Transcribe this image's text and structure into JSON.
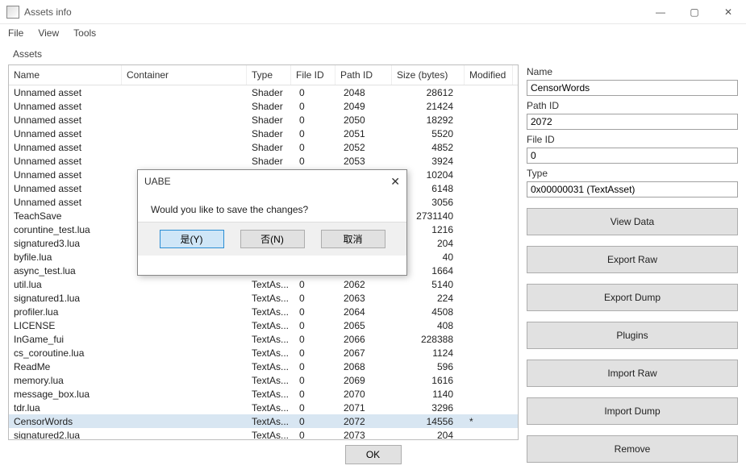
{
  "window": {
    "title": "Assets info"
  },
  "menu": {
    "file": "File",
    "view": "View",
    "tools": "Tools"
  },
  "assets_label": "Assets",
  "columns": {
    "name": "Name",
    "container": "Container",
    "type": "Type",
    "fileid": "File ID",
    "pathid": "Path ID",
    "size": "Size (bytes)",
    "modified": "Modified"
  },
  "rows": [
    {
      "name": "Unnamed asset",
      "container": "",
      "type": "Shader",
      "fileid": "0",
      "pathid": "2048",
      "size": "28612",
      "modified": ""
    },
    {
      "name": "Unnamed asset",
      "container": "",
      "type": "Shader",
      "fileid": "0",
      "pathid": "2049",
      "size": "21424",
      "modified": ""
    },
    {
      "name": "Unnamed asset",
      "container": "",
      "type": "Shader",
      "fileid": "0",
      "pathid": "2050",
      "size": "18292",
      "modified": ""
    },
    {
      "name": "Unnamed asset",
      "container": "",
      "type": "Shader",
      "fileid": "0",
      "pathid": "2051",
      "size": "5520",
      "modified": ""
    },
    {
      "name": "Unnamed asset",
      "container": "",
      "type": "Shader",
      "fileid": "0",
      "pathid": "2052",
      "size": "4852",
      "modified": ""
    },
    {
      "name": "Unnamed asset",
      "container": "",
      "type": "Shader",
      "fileid": "0",
      "pathid": "2053",
      "size": "3924",
      "modified": ""
    },
    {
      "name": "Unnamed asset",
      "container": "",
      "type": "",
      "fileid": "",
      "pathid": "",
      "size": "10204",
      "modified": ""
    },
    {
      "name": "Unnamed asset",
      "container": "",
      "type": "",
      "fileid": "",
      "pathid": "",
      "size": "6148",
      "modified": ""
    },
    {
      "name": "Unnamed asset",
      "container": "",
      "type": "",
      "fileid": "",
      "pathid": "",
      "size": "3056",
      "modified": ""
    },
    {
      "name": "TeachSave",
      "container": "",
      "type": "",
      "fileid": "",
      "pathid": "",
      "size": "2731140",
      "modified": ""
    },
    {
      "name": "coruntine_test.lua",
      "container": "",
      "type": "",
      "fileid": "",
      "pathid": "",
      "size": "1216",
      "modified": ""
    },
    {
      "name": "signatured3.lua",
      "container": "",
      "type": "",
      "fileid": "",
      "pathid": "",
      "size": "204",
      "modified": ""
    },
    {
      "name": "byfile.lua",
      "container": "",
      "type": "",
      "fileid": "",
      "pathid": "",
      "size": "40",
      "modified": ""
    },
    {
      "name": "async_test.lua",
      "container": "",
      "type": "",
      "fileid": "",
      "pathid": "",
      "size": "1664",
      "modified": ""
    },
    {
      "name": "util.lua",
      "container": "",
      "type": "TextAs...",
      "fileid": "0",
      "pathid": "2062",
      "size": "5140",
      "modified": ""
    },
    {
      "name": "signatured1.lua",
      "container": "",
      "type": "TextAs...",
      "fileid": "0",
      "pathid": "2063",
      "size": "224",
      "modified": ""
    },
    {
      "name": "profiler.lua",
      "container": "",
      "type": "TextAs...",
      "fileid": "0",
      "pathid": "2064",
      "size": "4508",
      "modified": ""
    },
    {
      "name": "LICENSE",
      "container": "",
      "type": "TextAs...",
      "fileid": "0",
      "pathid": "2065",
      "size": "408",
      "modified": ""
    },
    {
      "name": "InGame_fui",
      "container": "",
      "type": "TextAs...",
      "fileid": "0",
      "pathid": "2066",
      "size": "228388",
      "modified": ""
    },
    {
      "name": "cs_coroutine.lua",
      "container": "",
      "type": "TextAs...",
      "fileid": "0",
      "pathid": "2067",
      "size": "1124",
      "modified": ""
    },
    {
      "name": "ReadMe",
      "container": "",
      "type": "TextAs...",
      "fileid": "0",
      "pathid": "2068",
      "size": "596",
      "modified": ""
    },
    {
      "name": "memory.lua",
      "container": "",
      "type": "TextAs...",
      "fileid": "0",
      "pathid": "2069",
      "size": "1616",
      "modified": ""
    },
    {
      "name": "message_box.lua",
      "container": "",
      "type": "TextAs...",
      "fileid": "0",
      "pathid": "2070",
      "size": "1140",
      "modified": ""
    },
    {
      "name": "tdr.lua",
      "container": "",
      "type": "TextAs...",
      "fileid": "0",
      "pathid": "2071",
      "size": "3296",
      "modified": ""
    },
    {
      "name": "CensorWords",
      "container": "",
      "type": "TextAs...",
      "fileid": "0",
      "pathid": "2072",
      "size": "14556",
      "modified": "*",
      "selected": true
    },
    {
      "name": "signatured2.lua",
      "container": "",
      "type": "TextAs...",
      "fileid": "0",
      "pathid": "2073",
      "size": "204",
      "modified": ""
    }
  ],
  "side": {
    "name_label": "Name",
    "name_value": "CensorWords",
    "pathid_label": "Path ID",
    "pathid_value": "2072",
    "fileid_label": "File ID",
    "fileid_value": "0",
    "type_label": "Type",
    "type_value": "0x00000031 (TextAsset)",
    "view_data": "View Data",
    "export_raw": "Export Raw",
    "export_dump": "Export Dump",
    "plugins": "Plugins",
    "import_raw": "Import Raw",
    "import_dump": "Import Dump",
    "remove": "Remove"
  },
  "ok_label": "OK",
  "dialog": {
    "title": "UABE",
    "message": "Would you like to save the changes?",
    "yes": "是(Y)",
    "no": "否(N)",
    "cancel": "取消"
  }
}
